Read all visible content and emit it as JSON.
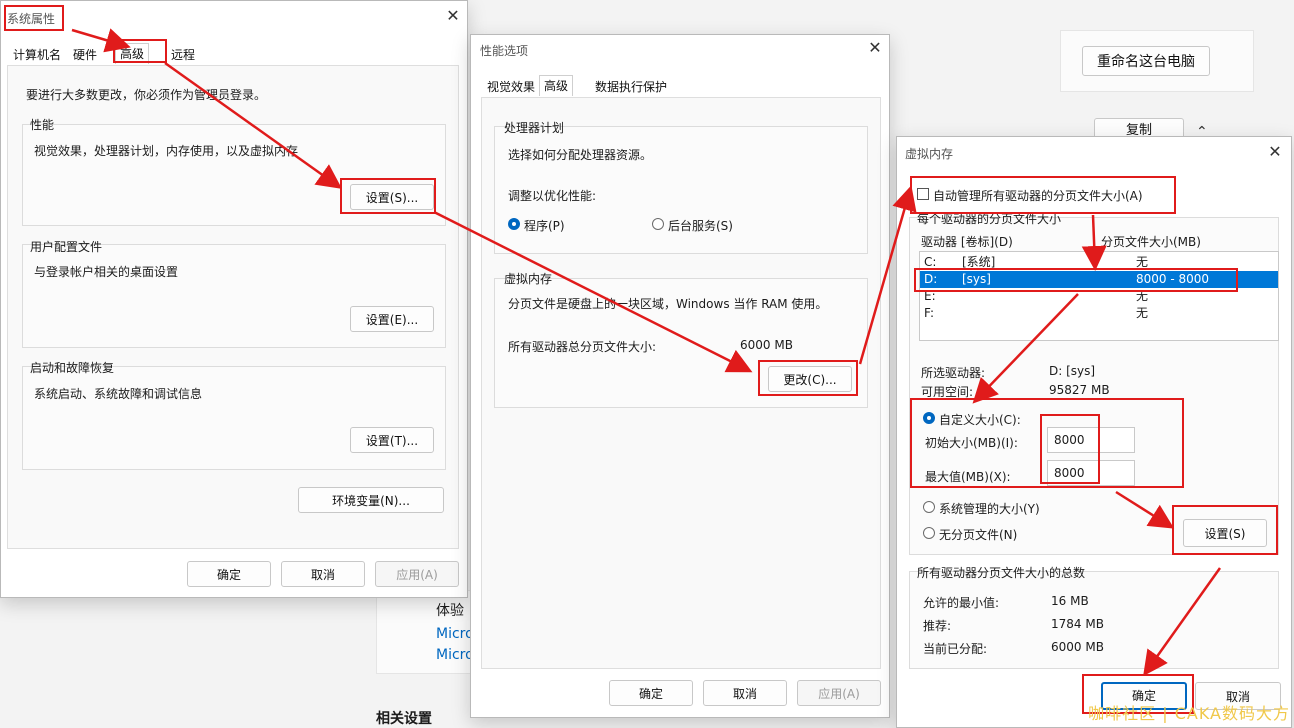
{
  "background": {
    "rename_button": "重命名这台电脑",
    "copy_button": "复制",
    "experience_label": "体验",
    "micro1": "Micro",
    "micro2": "Micro",
    "related_settings": "相关设置"
  },
  "system_properties": {
    "title": "系统属性",
    "tabs": [
      "计算机名",
      "硬件",
      "高级",
      "远程"
    ],
    "admin_note": "要进行大多数更改，你必须作为管理员登录。",
    "performance": {
      "label": "性能",
      "desc": "视觉效果，处理器计划，内存使用，以及虚拟内存",
      "button": "设置(S)..."
    },
    "user_profile": {
      "label": "用户配置文件",
      "desc": "与登录帐户相关的桌面设置",
      "button": "设置(E)..."
    },
    "startup": {
      "label": "启动和故障恢复",
      "desc": "系统启动、系统故障和调试信息",
      "button": "设置(T)..."
    },
    "env_button": "环境变量(N)...",
    "ok": "确定",
    "cancel": "取消",
    "apply": "应用(A)"
  },
  "performance_options": {
    "title": "性能选项",
    "tabs": [
      "视觉效果",
      "高级",
      "数据执行保护"
    ],
    "processor": {
      "label": "处理器计划",
      "desc": "选择如何分配处理器资源。",
      "adjust": "调整以优化性能:",
      "opt_programs": "程序(P)",
      "opt_services": "后台服务(S)"
    },
    "virtual_memory": {
      "label": "虚拟内存",
      "desc": "分页文件是硬盘上的一块区域，Windows 当作 RAM 使用。",
      "total_label": "所有驱动器总分页文件大小:",
      "total_value": "6000 MB",
      "change_button": "更改(C)..."
    },
    "ok": "确定",
    "cancel": "取消",
    "apply": "应用(A)"
  },
  "virtual_memory": {
    "title": "虚拟内存",
    "auto_manage": "自动管理所有驱动器的分页文件大小(A)",
    "per_drive_label": "每个驱动器的分页文件大小",
    "col_drive": "驱动器 [卷标](D)",
    "col_size": "分页文件大小(MB)",
    "drives": [
      {
        "drive": "C:",
        "label": "[系统]",
        "size": "无"
      },
      {
        "drive": "D:",
        "label": "[sys]",
        "size": "8000 - 8000"
      },
      {
        "drive": "E:",
        "label": "",
        "size": "无"
      },
      {
        "drive": "F:",
        "label": "",
        "size": "无"
      }
    ],
    "selected_drive_label": "所选驱动器:",
    "selected_drive_value": "D:  [sys]",
    "free_space_label": "可用空间:",
    "free_space_value": "95827 MB",
    "custom_size": "自定义大小(C):",
    "initial_label": "初始大小(MB)(I):",
    "initial_value": "8000",
    "max_label": "最大值(MB)(X):",
    "max_value": "8000",
    "system_managed": "系统管理的大小(Y)",
    "no_paging": "无分页文件(N)",
    "set_button": "设置(S)",
    "totals_label": "所有驱动器分页文件大小的总数",
    "min_allowed_label": "允许的最小值:",
    "min_allowed_value": "16 MB",
    "recommended_label": "推荐:",
    "recommended_value": "1784 MB",
    "allocated_label": "当前已分配:",
    "allocated_value": "6000 MB",
    "ok": "确定",
    "cancel": "取消"
  },
  "watermark": "咖啡社区 | CAKA数码大方",
  "colors": {
    "highlight": "#e01b1b",
    "accent": "#0067c0",
    "selection": "#0078d7"
  }
}
